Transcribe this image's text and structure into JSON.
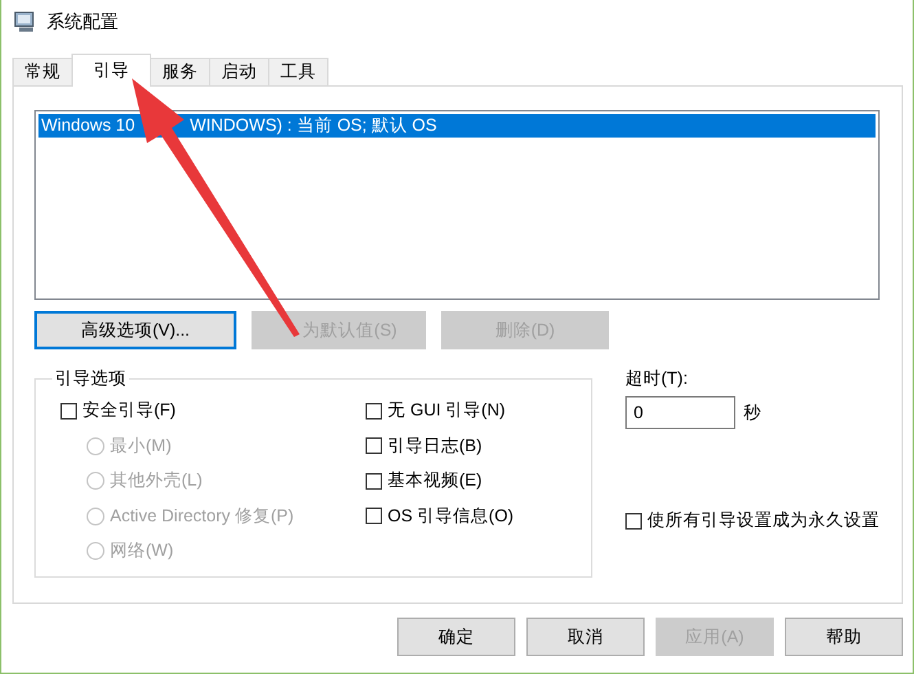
{
  "window": {
    "title": "系统配置"
  },
  "tabs": [
    {
      "label": "常规",
      "selected": false
    },
    {
      "label": "引导",
      "selected": true
    },
    {
      "label": "服务",
      "selected": false
    },
    {
      "label": "启动",
      "selected": false
    },
    {
      "label": "工具",
      "selected": false
    }
  ],
  "boot_list": [
    {
      "parts": [
        "Windows 10",
        "WINDOWS) : 当前 OS; 默认 OS"
      ],
      "selected": true
    }
  ],
  "boot_buttons": [
    {
      "label": "高级选项(V)...",
      "disabled": false,
      "focused": true
    },
    {
      "label": "为默认值(S)",
      "disabled": true,
      "focused": false
    },
    {
      "label": "删除(D)",
      "disabled": true,
      "focused": false
    }
  ],
  "boot_options": {
    "title": "引导选项",
    "left": [
      {
        "kind": "checkbox",
        "label": "安全引导(F)",
        "checked": false,
        "disabled": false
      },
      {
        "kind": "radio",
        "label": "最小(M)",
        "selected": false,
        "disabled": true
      },
      {
        "kind": "radio",
        "label": "其他外壳(L)",
        "selected": false,
        "disabled": true
      },
      {
        "kind": "radio",
        "label": "Active Directory 修复(P)",
        "selected": false,
        "disabled": true
      },
      {
        "kind": "radio",
        "label": "网络(W)",
        "selected": false,
        "disabled": true
      }
    ],
    "right": [
      {
        "kind": "checkbox",
        "label": "无 GUI 引导(N)",
        "checked": false,
        "disabled": false
      },
      {
        "kind": "checkbox",
        "label": "引导日志(B)",
        "checked": false,
        "disabled": false
      },
      {
        "kind": "checkbox",
        "label": "基本视频(E)",
        "checked": false,
        "disabled": false
      },
      {
        "kind": "checkbox",
        "label": "OS 引导信息(O)",
        "checked": false,
        "disabled": false
      }
    ]
  },
  "timeout": {
    "label": "超时(T):",
    "value": "0",
    "unit": "秒"
  },
  "permanent": {
    "kind": "checkbox",
    "label": "使所有引导设置成为永久设置",
    "checked": false,
    "disabled": false
  },
  "buttons": [
    {
      "label": "确定",
      "disabled": false
    },
    {
      "label": "取消",
      "disabled": false
    },
    {
      "label": "应用(A)",
      "disabled": true
    },
    {
      "label": "帮助",
      "disabled": false
    }
  ]
}
